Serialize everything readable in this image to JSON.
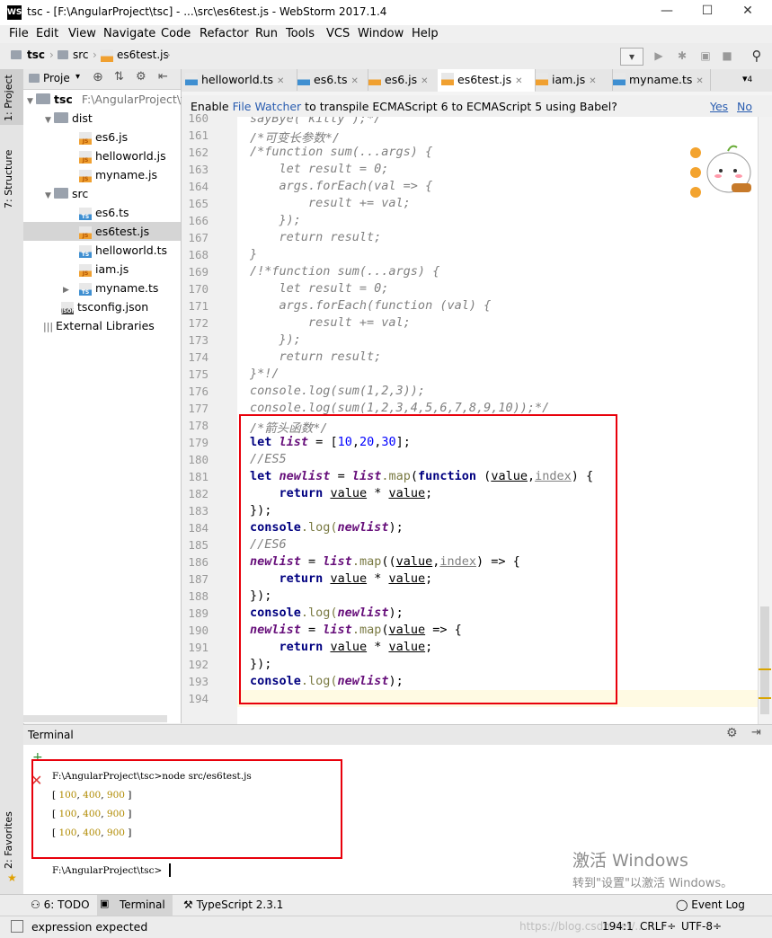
{
  "window": {
    "icon_text": "WS",
    "title": "tsc - [F:\\AngularProject\\tsc] - ...\\src\\es6test.js - WebStorm 2017.1.4"
  },
  "menu": [
    "File",
    "Edit",
    "View",
    "Navigate",
    "Code",
    "Refactor",
    "Run",
    "Tools",
    "VCS",
    "Window",
    "Help"
  ],
  "breadcrumbs": [
    "tsc",
    "src",
    "es6test.js"
  ],
  "project": {
    "header": "Proje",
    "root": "tsc",
    "root_path": "F:\\AngularProject\\t",
    "items": [
      {
        "name": "dist",
        "type": "folder"
      },
      {
        "name": "es6.js",
        "type": "js"
      },
      {
        "name": "helloworld.js",
        "type": "js"
      },
      {
        "name": "myname.js",
        "type": "js"
      },
      {
        "name": "src",
        "type": "folder"
      },
      {
        "name": "es6.ts",
        "type": "ts"
      },
      {
        "name": "es6test.js",
        "type": "js"
      },
      {
        "name": "helloworld.ts",
        "type": "ts"
      },
      {
        "name": "iam.js",
        "type": "js"
      },
      {
        "name": "myname.ts",
        "type": "ts"
      },
      {
        "name": "tsconfig.json",
        "type": "json"
      },
      {
        "name": "External Libraries",
        "type": "lib"
      }
    ]
  },
  "side_tabs": {
    "project": "1: Project",
    "structure": "7: Structure",
    "favorites": "2: Favorites"
  },
  "tabs": [
    "helloworld.ts",
    "es6.ts",
    "es6.js",
    "es6test.js",
    "iam.js",
    "myname.ts"
  ],
  "tabs_more": "▾",
  "tabs_more_count": "4",
  "notification": {
    "pre": "Enable ",
    "link": "File Watcher",
    "post": " to transpile ECMAScript 6 to ECMAScript 5 using Babel?",
    "yes": "Yes",
    "no": "No"
  },
  "code": {
    "top_partial": "sayBye(\"kitty\");*/",
    "lines": {
      "l161": "/*可变长参数*/",
      "l162": "/*function sum(...args) {",
      "l163": "    let result = 0;",
      "l164": "    args.forEach(val => {",
      "l165": "        result += val;",
      "l166": "    });",
      "l167": "    return result;",
      "l168": "}",
      "l169": "/!*function sum(...args) {",
      "l170": "    let result = 0;",
      "l171": "    args.forEach(function (val) {",
      "l172": "        result += val;",
      "l173": "    });",
      "l174": "    return result;",
      "l175": "}*!/",
      "l176": "console.log(sum(1,2,3));",
      "l177": "console.log(sum(1,2,3,4,5,6,7,8,9,10));*/",
      "l178": "/*箭头函数*/",
      "l180": "//ES5",
      "l185": "//ES6"
    },
    "tokens": {
      "let": "let",
      "list": "list",
      "eq": " = ",
      "lb": "[",
      "n10": "10",
      "c": ",",
      "n20": "20",
      "n30": "30",
      "rbs": "];",
      "newlist": "newlist",
      "dotmap": ".map",
      "function": "function",
      "value": "value",
      "index": "index",
      "paren_open": "(",
      "sp": " ",
      "close_brace": ") {",
      "ret": "return",
      "times": " * ",
      "semi": ";",
      "end": "});",
      "console": "console",
      "log": ".log(",
      "close": ");",
      "pre": "((",
      "arrow": ") => {",
      "arrow1": " => {"
    }
  },
  "line_numbers_start": 161,
  "line_numbers_end": 194,
  "terminal": {
    "title": "Terminal",
    "cmd": "F:\\AngularProject\\tsc>node src/es6test.js",
    "outputs": [
      "[ 100, 400, 900 ]",
      "[ 100, 400, 900 ]",
      "[ 100, 400, 900 ]"
    ],
    "prompt": "F:\\AngularProject\\tsc>",
    "watermark1": "激活 Windows",
    "watermark2": "转到\"设置\"以激活 Windows。"
  },
  "bottom_tabs": {
    "todo": "6: TODO",
    "terminal": "Terminal",
    "typescript": "TypeScript 2.3.1",
    "eventlog": "Event Log"
  },
  "status": {
    "message": "expression expected",
    "position": "194:1",
    "crlf": "CRLF÷",
    "encoding": "UTF-8÷",
    "url": "https://blog.csdn.net/..."
  },
  "colors": {
    "highlight_box": "#e8000b"
  }
}
